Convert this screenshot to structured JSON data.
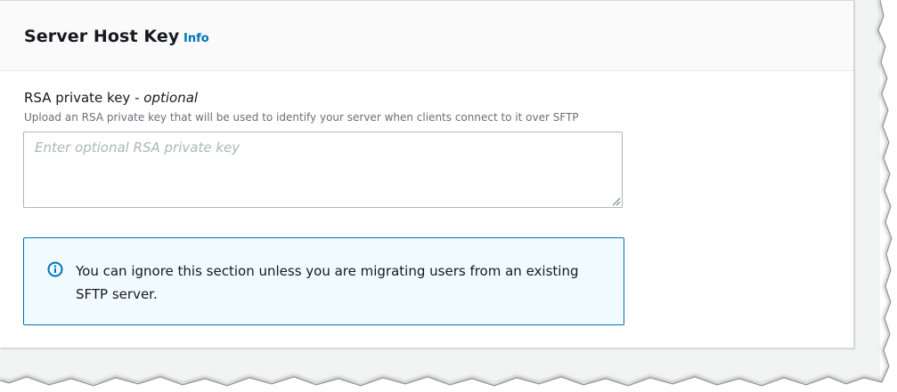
{
  "section": {
    "title": "Server Host Key",
    "info_link": "Info"
  },
  "rsa_field": {
    "label": "RSA private key - ",
    "label_optional": "optional",
    "description": "Upload an RSA private key that will be used to identify your server when clients connect to it over SFTP",
    "placeholder": "Enter optional RSA private key",
    "value": ""
  },
  "alert": {
    "icon": "info-circle-icon",
    "text": "You can ignore this section unless you are migrating users from an existing SFTP server."
  },
  "colors": {
    "link": "#0073bb",
    "alert_border": "#0073bb",
    "alert_background": "#f1faff",
    "header_background": "#fafafa",
    "text": "#16191f",
    "muted_text": "#687078"
  }
}
